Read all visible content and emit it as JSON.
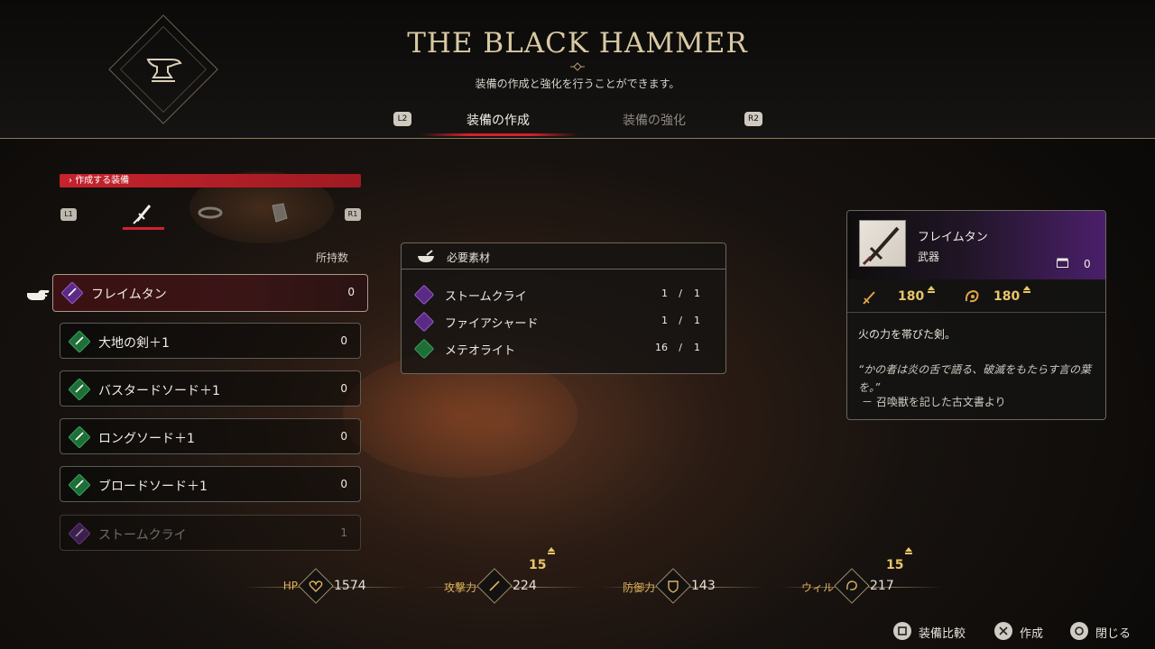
{
  "header": {
    "title": "THE BLACK HAMMER",
    "subtitle": "装備の作成と強化を行うことができます。",
    "tab_left_button": "L2",
    "tab_right_button": "R2",
    "tabs": [
      {
        "label": "装備の作成",
        "active": true
      },
      {
        "label": "装備の強化",
        "active": false
      }
    ],
    "emblem_icon": "anvil-icon"
  },
  "left": {
    "section_title": "作成する装備",
    "prev_button": "L1",
    "next_button": "R1",
    "categories": [
      {
        "icon": "sword-icon",
        "active": true
      },
      {
        "icon": "belt-icon",
        "active": false
      },
      {
        "icon": "bracer-icon",
        "active": false
      }
    ],
    "owned_header": "所持数",
    "items": [
      {
        "name": "フレイムタン",
        "count": "0",
        "gem": "purple",
        "selected": true,
        "disabled": false
      },
      {
        "name": "大地の剣＋1",
        "count": "0",
        "gem": "green",
        "selected": false,
        "disabled": false
      },
      {
        "name": "バスタードソード＋1",
        "count": "0",
        "gem": "green",
        "selected": false,
        "disabled": false
      },
      {
        "name": "ロングソード＋1",
        "count": "0",
        "gem": "green",
        "selected": false,
        "disabled": false
      },
      {
        "name": "ブロードソード＋1",
        "count": "0",
        "gem": "green",
        "selected": false,
        "disabled": false
      },
      {
        "name": "ストームクライ",
        "count": "1",
        "gem": "purple",
        "selected": false,
        "disabled": true
      }
    ]
  },
  "materials": {
    "title": "必要素材",
    "rows": [
      {
        "name": "ストームクライ",
        "have": "1",
        "need": "1",
        "gem": "purple"
      },
      {
        "name": "ファイアシャード",
        "have": "1",
        "need": "1",
        "gem": "purple"
      },
      {
        "name": "メテオライト",
        "have": "16",
        "need": "1",
        "gem": "green"
      }
    ]
  },
  "detail": {
    "name": "フレイムタン",
    "type": "武器",
    "owned": "0",
    "attack": "180",
    "stagger": "180",
    "description": "火の力を帯びた剣。",
    "quote": "“かの者は炎の舌で語る、破滅をもたらす言の葉を。”",
    "source": "－ 召喚獣を記した古文書より"
  },
  "stats": [
    {
      "label": "HP",
      "value": "1574",
      "bonus": "",
      "icon": "heart-icon"
    },
    {
      "label": "攻撃力",
      "value": "224",
      "bonus": "15",
      "icon": "sword-icon"
    },
    {
      "label": "防御力",
      "value": "143",
      "bonus": "",
      "icon": "shield-icon"
    },
    {
      "label": "ウィル",
      "value": "217",
      "bonus": "15",
      "icon": "will-icon"
    }
  ],
  "footer": {
    "compare_label": "装備比較",
    "craft_label": "作成",
    "close_label": "閉じる"
  },
  "colors": {
    "accent_red": "#d6202c",
    "gold": "#e8c56a",
    "gem_green": "#1e6e37",
    "gem_purple": "#5b2a85"
  }
}
